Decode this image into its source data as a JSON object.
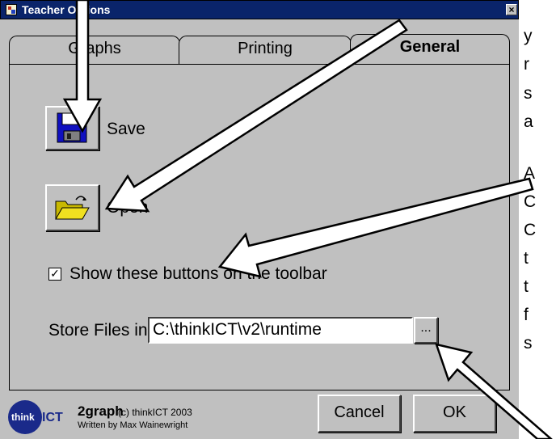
{
  "window": {
    "title": "Teacher Options",
    "close_glyph": "×"
  },
  "tabs": [
    {
      "label": "Graphs",
      "active": false
    },
    {
      "label": "Printing",
      "active": false
    },
    {
      "label": "General",
      "active": true
    }
  ],
  "general": {
    "save_label": "Save",
    "open_label": "Open",
    "show_buttons_label": "Show these buttons on the toolbar",
    "show_buttons_checked": true,
    "checkbox_glyph": "✓",
    "store_files_label": "Store Files in:",
    "store_path": "C:\\thinkICT\\v2\\runtime",
    "browse_label": "..."
  },
  "footer": {
    "logo_think": "think",
    "logo_ict": "ICT",
    "app_name": "2graph",
    "copyright": "(c) thinkICT 2003",
    "author": "Written by Max Wainewright",
    "cancel_label": "Cancel",
    "ok_label": "OK"
  },
  "side_text": [
    "y",
    "r",
    "s",
    "a",
    "A",
    "C",
    "C",
    "t",
    "t",
    "f",
    "s"
  ],
  "colors": {
    "titlebar": "#0a246a",
    "dialog": "#c0c0c0",
    "logo": "#1a2a8a",
    "floppy": "#1010c0",
    "folder": "#f0e020"
  },
  "icons": {
    "save": "floppy-disk-icon",
    "open": "folder-open-icon"
  }
}
